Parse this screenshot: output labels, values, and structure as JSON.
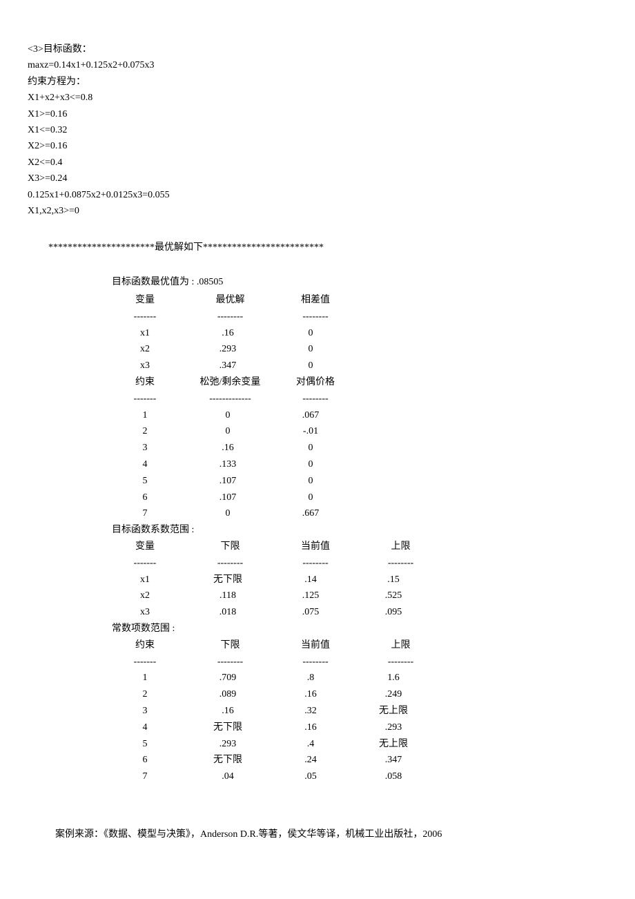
{
  "problem": {
    "line1": "<3>目标函数：",
    "line2": "maxz=0.14x1+0.125x2+0.075x3",
    "line3": "约束方程为：",
    "line4": "X1+x2+x3<=0.8",
    "line5": "X1>=0.16",
    "line6": "X1<=0.32",
    "line7": "X2>=0.16",
    "line8": "X2<=0.4",
    "line9": "X3>=0.24",
    "line10": "0.125x1+0.0875x2+0.0125x3=0.055",
    "line11": "X1,x2,x3>=0"
  },
  "result_header": "**********************最优解如下*************************",
  "optimal": {
    "title": "目标函数最优值为   :  .08505",
    "headers": {
      "col1": "变量",
      "col2": "最优解",
      "col3": "相差值"
    },
    "dashes": {
      "d1": "-------",
      "d2": "--------",
      "d3": "--------"
    },
    "rows": [
      {
        "c1": "x1",
        "c2": ".16",
        "c3": "0"
      },
      {
        "c1": "x2",
        "c2": ".293",
        "c3": "0"
      },
      {
        "c1": "x3",
        "c2": ".347",
        "c3": "0"
      }
    ]
  },
  "slack": {
    "headers": {
      "col1": "约束",
      "col2": "松弛/剩余变量",
      "col3": "对偶价格"
    },
    "dashes": {
      "d1": "-------",
      "d2": "-------------",
      "d3": "--------"
    },
    "rows": [
      {
        "c1": "1",
        "c2": "0",
        "c3": ".067"
      },
      {
        "c1": "2",
        "c2": "0",
        "c3": "-.01"
      },
      {
        "c1": "3",
        "c2": ".16",
        "c3": "0"
      },
      {
        "c1": "4",
        "c2": ".133",
        "c3": "0"
      },
      {
        "c1": "5",
        "c2": ".107",
        "c3": "0"
      },
      {
        "c1": "6",
        "c2": ".107",
        "c3": "0"
      },
      {
        "c1": "7",
        "c2": "0",
        "c3": ".667"
      }
    ]
  },
  "obj_range": {
    "title": "目标函数系数范围  :",
    "headers": {
      "col1": "变量",
      "col2": "下限",
      "col3": "当前值",
      "col4": "上限"
    },
    "dashes": {
      "d1": "-------",
      "d2": "--------",
      "d3": "--------",
      "d4": "--------"
    },
    "rows": [
      {
        "c1": "x1",
        "c2": "无下限",
        "c3": ".14",
        "c4": ".15"
      },
      {
        "c1": "x2",
        "c2": ".118",
        "c3": ".125",
        "c4": ".525"
      },
      {
        "c1": "x3",
        "c2": ".018",
        "c3": ".075",
        "c4": ".095"
      }
    ]
  },
  "rhs_range": {
    "title": "常数项数范围  :",
    "headers": {
      "col1": "约束",
      "col2": "下限",
      "col3": "当前值",
      "col4": "上限"
    },
    "dashes": {
      "d1": "-------",
      "d2": "--------",
      "d3": "--------",
      "d4": "--------"
    },
    "rows": [
      {
        "c1": "1",
        "c2": ".709",
        "c3": ".8",
        "c4": "1.6"
      },
      {
        "c1": "2",
        "c2": ".089",
        "c3": ".16",
        "c4": ".249"
      },
      {
        "c1": "3",
        "c2": ".16",
        "c3": ".32",
        "c4": "无上限"
      },
      {
        "c1": "4",
        "c2": "无下限",
        "c3": ".16",
        "c4": ".293"
      },
      {
        "c1": "5",
        "c2": ".293",
        "c3": ".4",
        "c4": "无上限"
      },
      {
        "c1": "6",
        "c2": "无下限",
        "c3": ".24",
        "c4": ".347"
      },
      {
        "c1": "7",
        "c2": ".04",
        "c3": ".05",
        "c4": ".058"
      }
    ]
  },
  "footer": "案例来源：《数据、模型与决策》，Anderson D.R.等著，侯文华等译，机械工业出版社，2006"
}
